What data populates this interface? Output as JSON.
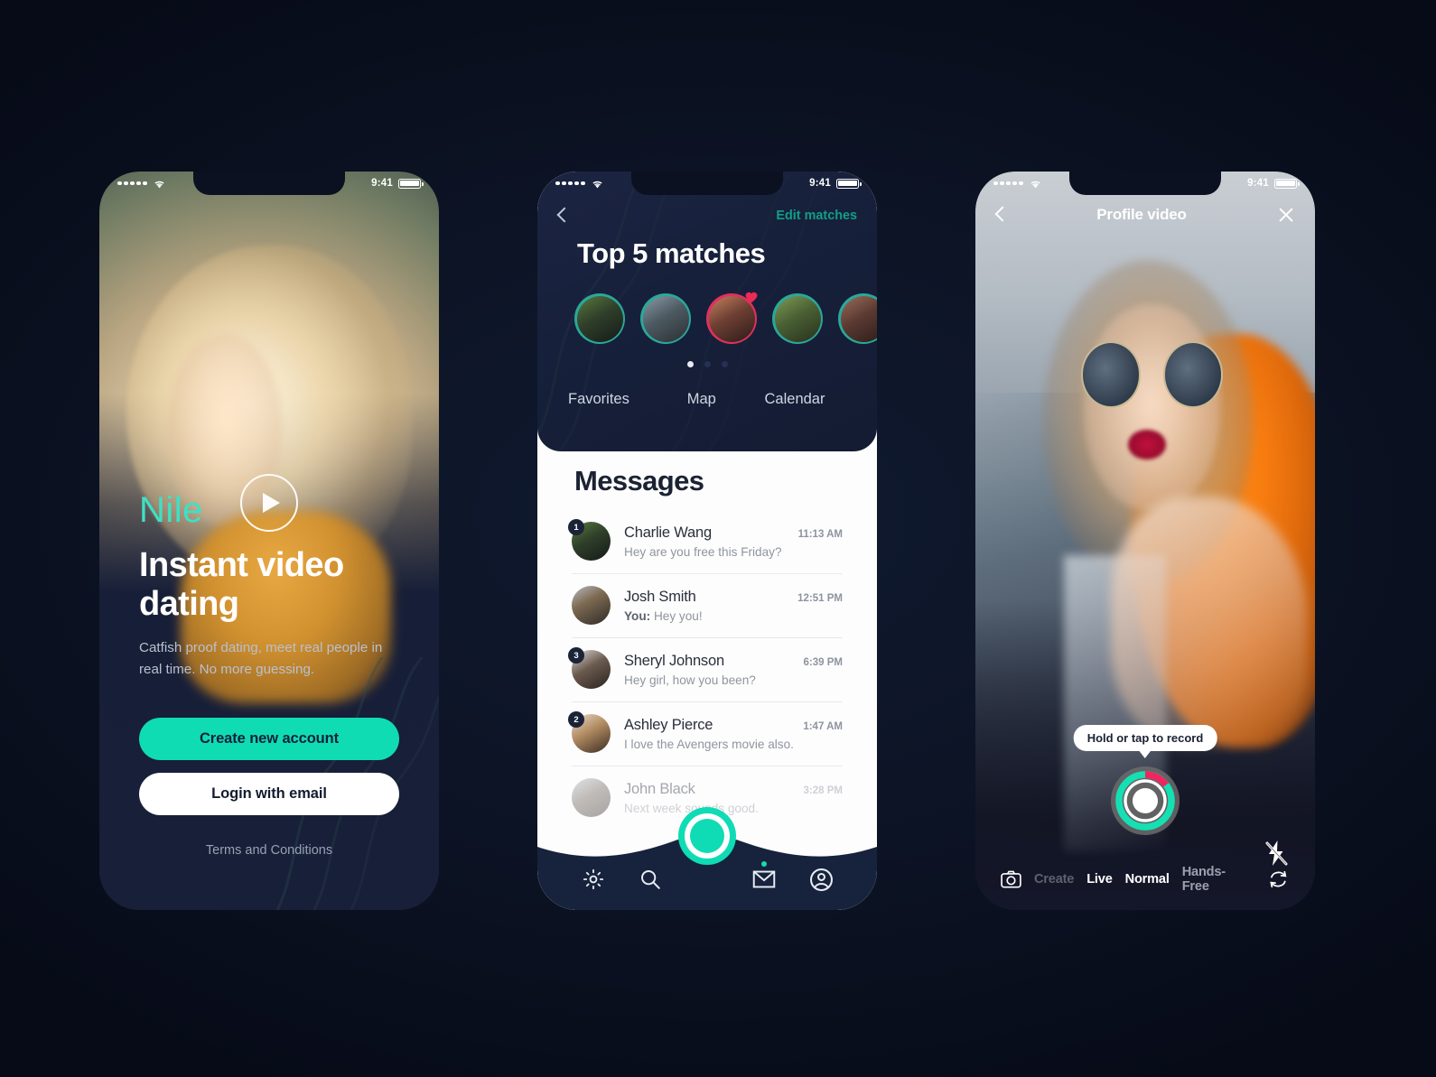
{
  "theme": {
    "accent": "#10dcb4",
    "accent_dark": "#119e86",
    "pink": "#e0305f",
    "page_bg": "#0c1324",
    "dark_panel": "#17203b"
  },
  "status_bar": {
    "time": "9:41",
    "signal_dots": 5,
    "wifi_icon": "wifi-icon",
    "battery_icon": "battery-full-icon"
  },
  "screens": [
    {
      "id": "onboarding",
      "brand": "Nile",
      "headline": "Instant video dating",
      "subhead": "Catfish proof dating, meet real people in real time. No more guessing.",
      "play_icon": "play-circle-icon",
      "primary_button": "Create new account",
      "secondary_button": "Login with email",
      "terms_link": "Terms and Conditions"
    },
    {
      "id": "matches-messages",
      "back_icon": "chevron-left-icon",
      "edit_link": "Edit matches",
      "title": "Top 5 matches",
      "matches": [
        {
          "name": "match-1",
          "ring": "teal",
          "favorite": false
        },
        {
          "name": "match-2",
          "ring": "teal",
          "favorite": false
        },
        {
          "name": "match-3",
          "ring": "pink",
          "favorite": true
        },
        {
          "name": "match-4",
          "ring": "teal",
          "favorite": false
        },
        {
          "name": "match-5",
          "ring": "teal",
          "favorite": false
        }
      ],
      "pager": {
        "count": 3,
        "active": 0
      },
      "tabs": [
        {
          "label": "Favorites",
          "active": false
        },
        {
          "label": "Map",
          "active": false
        },
        {
          "label": "Calendar",
          "active": false
        }
      ],
      "messages_title": "Messages",
      "messages": [
        {
          "name": "Charlie Wang",
          "preview": "Hey are you free this Friday?",
          "prefix": "",
          "time": "11:13 AM",
          "unread": "1",
          "faded": false
        },
        {
          "name": "Josh Smith",
          "preview": "Hey you!",
          "prefix": "You:",
          "time": "12:51 PM",
          "unread": "",
          "faded": false
        },
        {
          "name": "Sheryl Johnson",
          "preview": "Hey girl, how you been?",
          "prefix": "",
          "time": "6:39 PM",
          "unread": "3",
          "faded": false
        },
        {
          "name": "Ashley Pierce",
          "preview": "I love the Avengers movie also.",
          "prefix": "",
          "time": "1:47 AM",
          "unread": "2",
          "faded": false
        },
        {
          "name": "John Black",
          "preview": "Next week sounds good.",
          "prefix": "",
          "time": "3:28 PM",
          "unread": "",
          "faded": true
        }
      ],
      "bottom_nav": [
        {
          "icon": "gear-icon",
          "label": "Settings",
          "badge": false
        },
        {
          "icon": "search-icon",
          "label": "Search",
          "badge": false
        },
        {
          "icon": "record-icon",
          "label": "Record",
          "badge": false
        },
        {
          "icon": "envelope-icon",
          "label": "Messages",
          "badge": true
        },
        {
          "icon": "profile-icon",
          "label": "Profile",
          "badge": false
        }
      ]
    },
    {
      "id": "profile-video",
      "back_icon": "chevron-left-icon",
      "title": "Profile video",
      "close_icon": "close-icon",
      "tooltip": "Hold or tap to record",
      "record_icon": "record-ring-icon",
      "flash_icon": "flash-off-icon",
      "flip_icon": "camera-flip-icon",
      "camera_icon": "camera-icon",
      "modes": [
        {
          "label": "Create",
          "state": "dim"
        },
        {
          "label": "Live",
          "state": "on"
        },
        {
          "label": "Normal",
          "state": "on"
        },
        {
          "label": "Hands-Free",
          "state": "semi"
        }
      ]
    }
  ]
}
